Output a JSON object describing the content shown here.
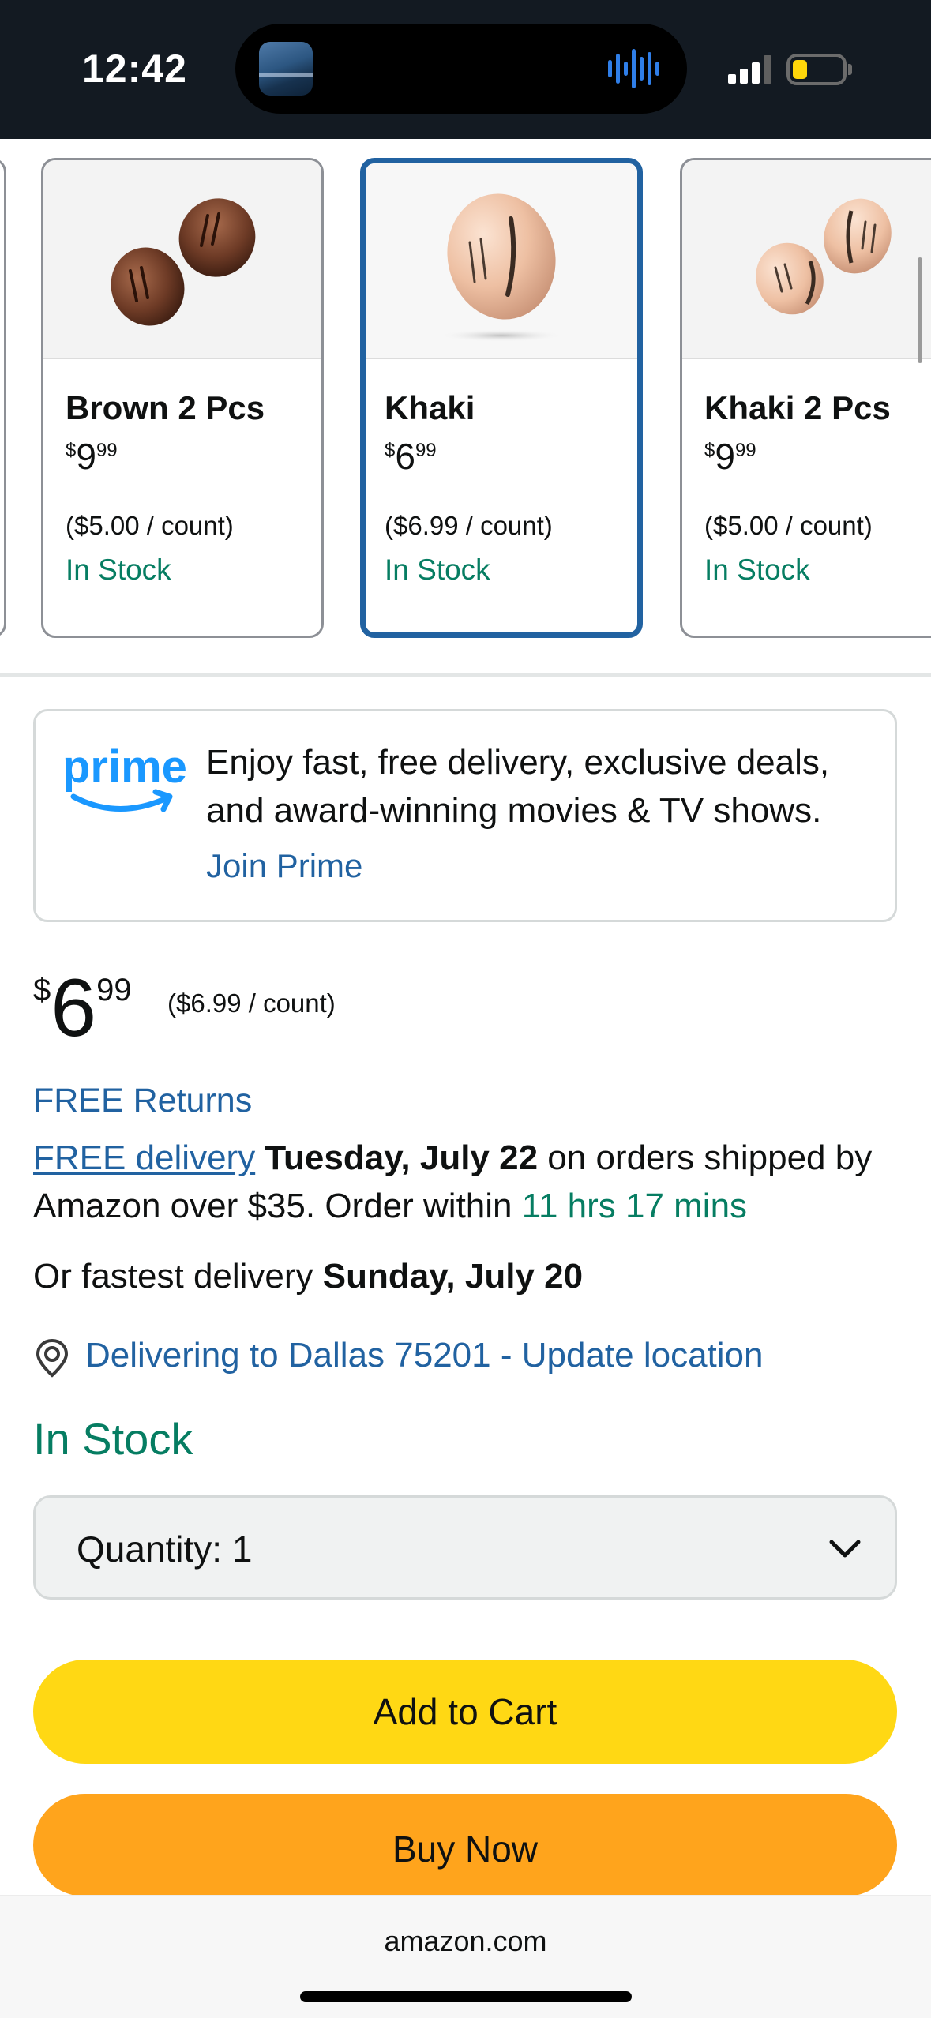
{
  "status_bar": {
    "time": "12:42"
  },
  "variants": [
    {
      "title": "Brown 2 Pcs",
      "price_symbol": "$",
      "price_whole": "9",
      "price_fraction": "99",
      "unit_price": "($5.00 / count)",
      "stock": "In Stock",
      "selected": false
    },
    {
      "title": "Khaki",
      "price_symbol": "$",
      "price_whole": "6",
      "price_fraction": "99",
      "unit_price": "($6.99 / count)",
      "stock": "In Stock",
      "selected": true
    },
    {
      "title": "Khaki 2 Pcs",
      "price_symbol": "$",
      "price_whole": "9",
      "price_fraction": "99",
      "unit_price": "($5.00 / count)",
      "stock": "In Stock",
      "selected": false
    }
  ],
  "prime": {
    "logo_text": "prime",
    "description": "Enjoy fast, free delivery, exclusive deals, and award-winning movies & TV shows.",
    "join_label": "Join Prime",
    "brand_color": "#1a98ff"
  },
  "price": {
    "symbol": "$",
    "whole": "6",
    "fraction": "99",
    "unit_price": "($6.99 / count)"
  },
  "returns": "FREE Returns",
  "delivery": {
    "link": "FREE delivery",
    "date": "Tuesday, July 22",
    "text_1": " on orders shipped by Amazon over $35. Order within ",
    "countdown": "11 hrs 17 mins"
  },
  "fastest": {
    "prefix": "Or fastest delivery ",
    "date": "Sunday, July 20"
  },
  "location": {
    "icon": "location-pin-icon",
    "text": "Delivering to Dallas 75201 - Update location"
  },
  "availability": "In Stock",
  "quantity": {
    "label": "Quantity:",
    "value": "1"
  },
  "buttons": {
    "add_to_cart": "Add to Cart",
    "buy_now": "Buy Now"
  },
  "browser": {
    "url": "amazon.com"
  },
  "colors": {
    "link_blue": "#2162a1",
    "stock_green": "#067d62",
    "add_to_cart_yellow": "#ffd814",
    "buy_now_orange": "#ffa41c",
    "selected_border": "#2162a1"
  }
}
